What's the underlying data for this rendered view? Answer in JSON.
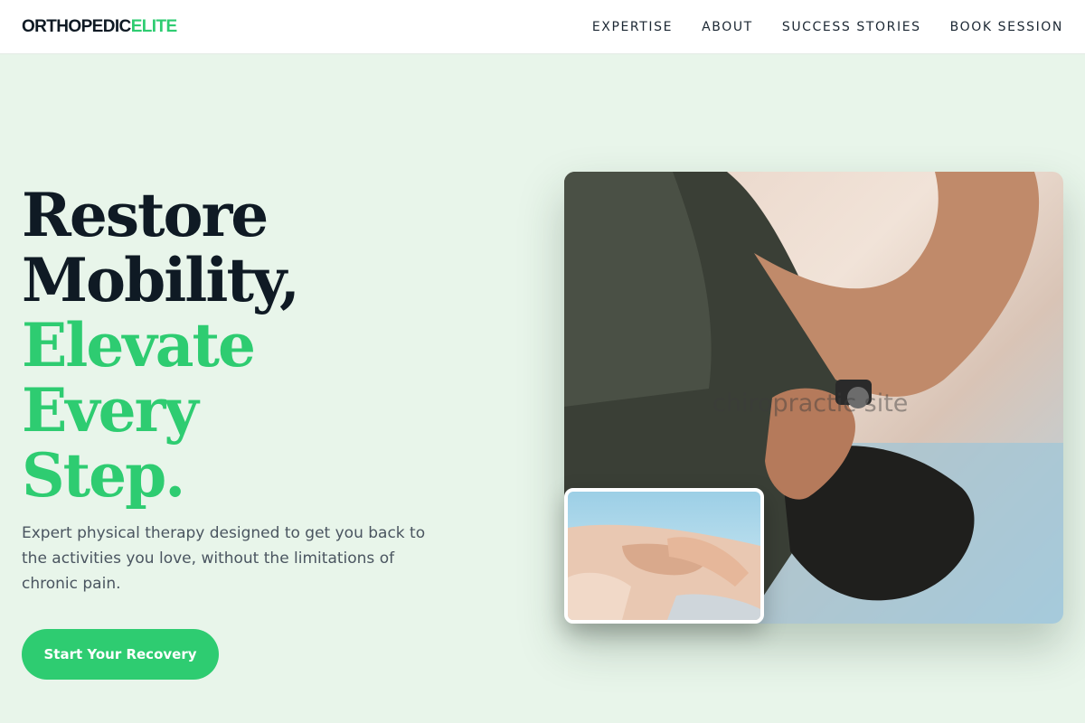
{
  "brand": {
    "part1": "ORTHOPEDIC",
    "part2": "ELITE"
  },
  "nav": {
    "items": [
      {
        "label": "EXPERTISE"
      },
      {
        "label": "ABOUT"
      },
      {
        "label": "SUCCESS STORIES"
      },
      {
        "label": "BOOK SESSION"
      }
    ]
  },
  "hero": {
    "headline_dark_1": "Restore",
    "headline_dark_2": "Mobility,",
    "headline_green_1": "Elevate Every",
    "headline_green_2": "Step.",
    "lede": "Expert physical therapy designed to get you back to the activities you love, without the limitations of chronic pain.",
    "cta_label": "Start Your Recovery",
    "image_alt": "chiropractic site"
  },
  "colors": {
    "accent": "#2ecc71",
    "dark": "#0f1a24",
    "background": "#e8f5ea"
  }
}
